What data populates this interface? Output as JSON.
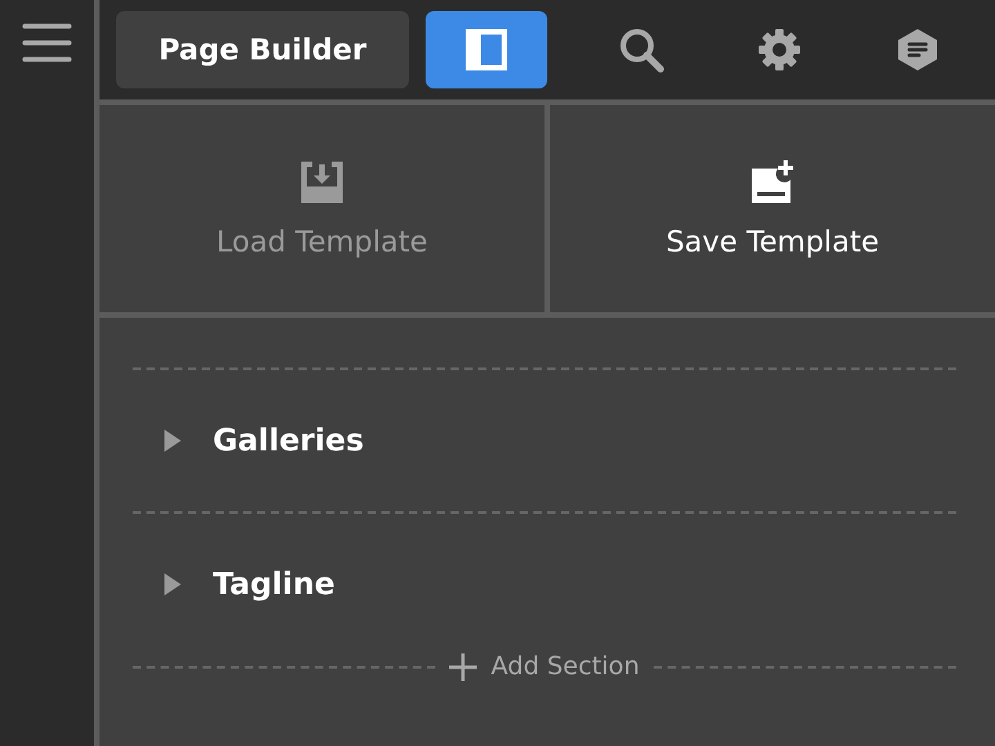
{
  "toolbar": {
    "title": "Page Builder",
    "tools": [
      {
        "kind": "layout",
        "selected": true
      },
      {
        "kind": "search",
        "selected": false
      },
      {
        "kind": "settings",
        "selected": false
      },
      {
        "kind": "notes",
        "selected": false
      }
    ]
  },
  "templates": [
    {
      "kind": "load",
      "label": "Load Template",
      "disabled": true
    },
    {
      "kind": "save",
      "label": "Save Template",
      "disabled": false
    }
  ],
  "sections": [
    {
      "label": "Galleries",
      "expanded": false
    },
    {
      "label": "Tagline",
      "expanded": false
    }
  ],
  "add_section": "Add Section"
}
